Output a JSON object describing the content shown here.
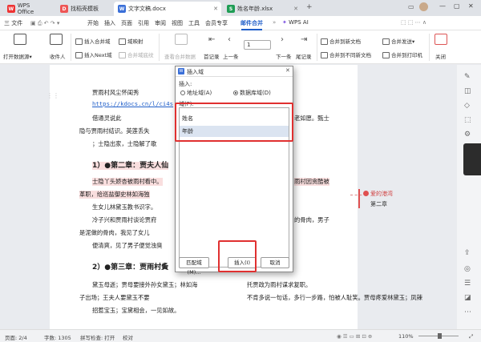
{
  "tabs": [
    {
      "label": "WPS Office",
      "icon": "wps-logo-icon"
    },
    {
      "label": "找稻壳模板",
      "icon": "docer-icon"
    },
    {
      "label": "文字文稿.docx",
      "icon": "word-doc-icon"
    },
    {
      "label": "姓名年龄.xlsx",
      "icon": "excel-doc-icon"
    }
  ],
  "menu": {
    "file": "三 文件",
    "items": [
      "开始",
      "插入",
      "页面",
      "引用",
      "审阅",
      "视图",
      "工具",
      "会员专享"
    ],
    "active": "邮件合并",
    "ai": "WPS AI"
  },
  "ribbon": {
    "open_source": "打开数据源▾",
    "recipients": "收件人",
    "insert_merge_field": "插入合并域",
    "insert_next": "插入Next域",
    "combine_fields": "合并域底纹",
    "field": "域映射",
    "view_merged": "查看合并数据",
    "first": "首记录",
    "prev": "上一条",
    "record_no": "1",
    "next": "下一条",
    "last": "尾记录",
    "merge_new_doc": "合并到新文档",
    "merge_diff_doc": "合并到不同新文档",
    "merge_send": "合并发送▾",
    "merge_print": "合并到打印机",
    "close": "关闭"
  },
  "document": {
    "lines": [
      "贾雨村风尘怀闺秀",
      "https://kdocs.cn/l/ci4s",
      "借通灵说此",
      "隐与贾雨村结识。英莲丢失",
      "；士隐出家，士隐解了歌",
      "1）●第二章：贾夫人仙",
      "士隐丫头娇杏被雨村看中。",
      "革职，给巡盐御史林如海独",
      "生女儿林黛玉教书识字。",
      "冷子兴和贾雨村谈论贾府",
      "是泥做的骨肉，我见了女儿",
      "便清爽，见了男子便觉浊臭",
      "2）●第三章：贾雨村夤",
      "黛玉母逝；贾母要接外孙女黛玉；林如海",
      "子出场；王夫人要黛玉不要",
      "招惹宝玉；宝黛相会，一见如故。"
    ],
    "right_fragments": [
      "老如愿。甄士",
      "雨村因贪酷被",
      "的骨肉，男子"
    ],
    "mid_fragment": "不肯多说一句话，多行一步路，怕被人耻笑。贾母疼爱林黛玉；凤辣",
    "mid_fragment2": "托贾政为雨村谋求复职。"
  },
  "comment": {
    "author": "爱的港湾",
    "text": "第二章"
  },
  "dialog": {
    "title": "插入域",
    "insert_label": "插入:",
    "opt_address": "地址域(A)",
    "opt_database": "数据库域(D)",
    "fields_label": "域(F):",
    "fields": [
      "姓名",
      "年龄"
    ],
    "match_btn": "匹配域(M)...",
    "insert_btn": "插入(I)",
    "cancel_btn": "取消"
  },
  "status": {
    "page": "页面: 2/4",
    "words": "字数: 1305",
    "spell": "拼写检查: 打开",
    "proof": "校对",
    "zoom": "110%"
  },
  "colors": {
    "accent": "#1f5ec9",
    "highlight": "#e03030"
  }
}
